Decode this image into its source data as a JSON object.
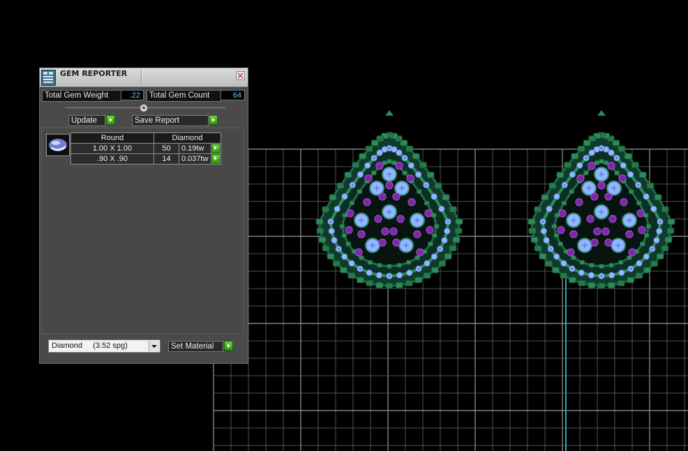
{
  "window": {
    "title": "GEM REPORTER",
    "icon": "gem-reporter-app-icon",
    "close_icon": "close-icon"
  },
  "summary": {
    "total_weight_label": "Total Gem Weight",
    "total_weight_value": ".22",
    "total_count_label": "Total Gem Count",
    "total_count_value": "64"
  },
  "actions": {
    "update_label": "Update",
    "save_report_label": "Save Report"
  },
  "gem_table": {
    "shape": "Round",
    "material": "Diamond",
    "thumbnail_icon": "oval-gem-icon",
    "rows": [
      {
        "size": "1.00 X 1.00",
        "count": "50",
        "weight": "0.19tw"
      },
      {
        "size": ".90 X .90",
        "count": "14",
        "weight": "0.037tw"
      }
    ]
  },
  "material": {
    "selected": "Diamond     (3.52 spg)",
    "set_label": "Set Material"
  },
  "colors": {
    "background": "#000000",
    "grid_line": "#6a6a6a",
    "axis_line": "#2aa7c9",
    "metal_green": "#2e8b57",
    "stone_blue": "#8fb8ff",
    "stone_purple": "#7a2aa6",
    "accent_value": "#5fc8ff",
    "button_green": "#3cb02a"
  }
}
